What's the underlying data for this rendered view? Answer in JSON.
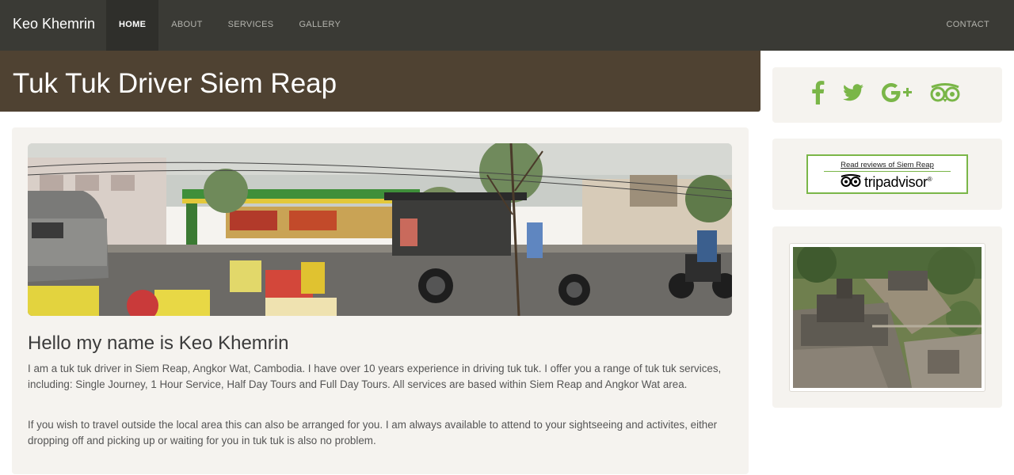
{
  "brand": "Keo Khemrin",
  "nav": {
    "items": [
      "HOME",
      "ABOUT",
      "SERVICES",
      "GALLERY"
    ],
    "active": "HOME",
    "contact": "CONTACT"
  },
  "page_title": "Tuk Tuk Driver Siem Reap",
  "main": {
    "hero_image": "siem-reap-street-tuk-tuk-photo",
    "heading": "Hello my name is Keo Khemrin",
    "paragraphs": [
      "I am a tuk tuk driver in Siem Reap, Angkor Wat, Cambodia. I have over 10 years experience in driving tuk tuk. I offer you a range of tuk tuk services, including: Single Journey, 1 Hour Service, Half Day Tours and Full Day Tours. All services are based within Siem Reap and Angkor Wat area.",
      "If you wish to travel outside the local area this can also be arranged for you. I am always available to attend to your sightseeing and activites, either dropping off and picking up or waiting for you in tuk tuk is also no problem."
    ]
  },
  "sidebar": {
    "social_icons": [
      "facebook-icon",
      "twitter-icon",
      "google-plus-icon",
      "tripadvisor-icon"
    ],
    "tripadvisor_badge": {
      "read_text": "Read reviews of Siem Reap",
      "logo_text": "tripadvisor",
      "logo_mark": "®"
    },
    "temple_image": "angkor-temple-aerial-photo"
  },
  "colors": {
    "navbar": "#3a3a35",
    "banner": "#4f4232",
    "panel": "#f5f3ef",
    "social_green": "#7ab648"
  }
}
